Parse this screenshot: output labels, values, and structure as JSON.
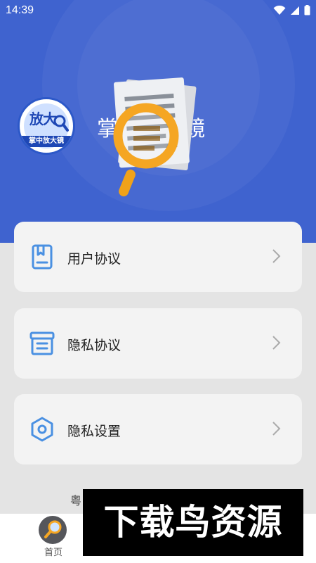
{
  "status_bar": {
    "time": "14:39",
    "icons": [
      "wifi-icon",
      "signal-icon",
      "battery-icon"
    ]
  },
  "header": {
    "app_title": "掌中放大镜",
    "logo": {
      "top_text": "放大",
      "bottom_text": "掌中放大镜"
    },
    "background_color": "#3f63cf"
  },
  "menu": {
    "items": [
      {
        "label": "用户协议",
        "icon": "document-icon"
      },
      {
        "label": "隐私协议",
        "icon": "archive-icon"
      },
      {
        "label": "隐私设置",
        "icon": "settings-hexagon-icon"
      }
    ],
    "icon_color": "#4a90e2"
  },
  "footer": {
    "text": "粤"
  },
  "tabbar": {
    "tabs": [
      {
        "label": "首页",
        "icon": "magnifier-icon"
      }
    ]
  },
  "watermark": {
    "text": "下载鸟资源"
  }
}
